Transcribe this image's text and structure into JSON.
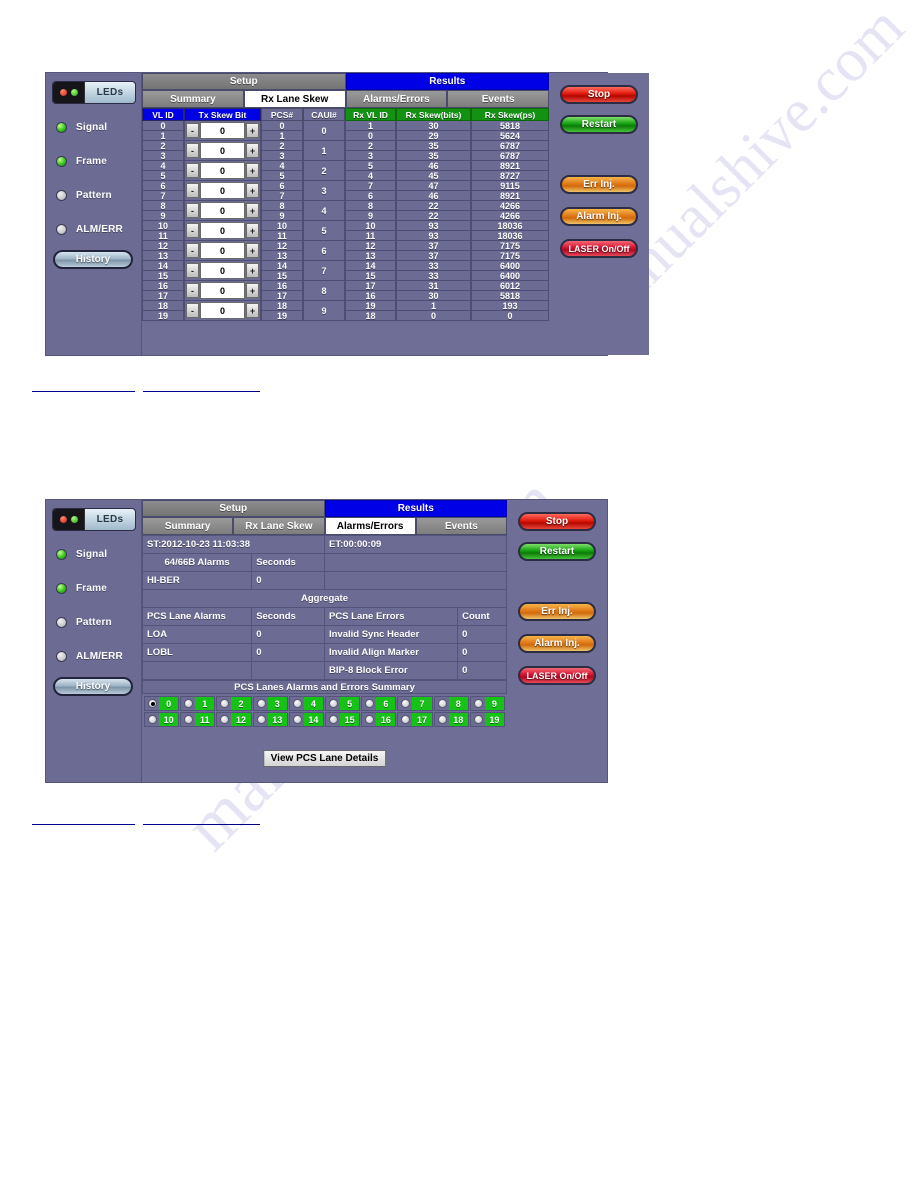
{
  "watermarks": [
    "manualshive.com",
    ".com",
    "ma"
  ],
  "panel1": {
    "name": "Rx Lane Skew screen",
    "leds": {
      "header_label": "LEDs",
      "items": [
        {
          "label": "Signal",
          "state": "on"
        },
        {
          "label": "Frame",
          "state": "on"
        },
        {
          "label": "Pattern",
          "state": "off"
        },
        {
          "label": "ALM/ERR",
          "state": "off"
        }
      ],
      "history_label": "History"
    },
    "main_tabs": [
      {
        "label": "Setup",
        "active": false
      },
      {
        "label": "Results",
        "active": true
      }
    ],
    "sub_tabs": [
      {
        "label": "Summary",
        "active": false
      },
      {
        "label": "Rx Lane Skew",
        "active": true
      },
      {
        "label": "Alarms/Errors",
        "active": false
      },
      {
        "label": "Events",
        "active": false
      }
    ],
    "table": {
      "headers": [
        "VL ID",
        "Tx Skew Bit",
        "PCS#",
        "CAUI#",
        "Rx VL ID",
        "Rx Skew(bits)",
        "Rx Skew(ps)"
      ],
      "vl_ids": [
        "0",
        "1",
        "2",
        "3",
        "4",
        "5",
        "6",
        "7",
        "8",
        "9",
        "10",
        "11",
        "12",
        "13",
        "14",
        "15",
        "16",
        "17",
        "18",
        "19"
      ],
      "tx_skew_values": [
        "0",
        "0",
        "0",
        "0",
        "0",
        "0",
        "0",
        "0",
        "0",
        "0"
      ],
      "spin_minus": "-",
      "spin_plus": "+",
      "pcs_numbers": [
        "0",
        "1",
        "2",
        "3",
        "4",
        "5",
        "6",
        "7",
        "8",
        "9",
        "10",
        "11",
        "12",
        "13",
        "14",
        "15",
        "16",
        "17",
        "18",
        "19"
      ],
      "caui_numbers": [
        "0",
        "1",
        "2",
        "3",
        "4",
        "5",
        "6",
        "7",
        "8",
        "9"
      ],
      "rx_rows": [
        {
          "vl": "1",
          "bits": "30",
          "ps": "5818"
        },
        {
          "vl": "0",
          "bits": "29",
          "ps": "5624"
        },
        {
          "vl": "2",
          "bits": "35",
          "ps": "6787"
        },
        {
          "vl": "3",
          "bits": "35",
          "ps": "6787"
        },
        {
          "vl": "5",
          "bits": "46",
          "ps": "8921"
        },
        {
          "vl": "4",
          "bits": "45",
          "ps": "8727"
        },
        {
          "vl": "7",
          "bits": "47",
          "ps": "9115"
        },
        {
          "vl": "6",
          "bits": "46",
          "ps": "8921"
        },
        {
          "vl": "8",
          "bits": "22",
          "ps": "4266"
        },
        {
          "vl": "9",
          "bits": "22",
          "ps": "4266"
        },
        {
          "vl": "10",
          "bits": "93",
          "ps": "18036"
        },
        {
          "vl": "11",
          "bits": "93",
          "ps": "18036"
        },
        {
          "vl": "12",
          "bits": "37",
          "ps": "7175"
        },
        {
          "vl": "13",
          "bits": "37",
          "ps": "7175"
        },
        {
          "vl": "14",
          "bits": "33",
          "ps": "6400"
        },
        {
          "vl": "15",
          "bits": "33",
          "ps": "6400"
        },
        {
          "vl": "17",
          "bits": "31",
          "ps": "6012"
        },
        {
          "vl": "16",
          "bits": "30",
          "ps": "5818"
        },
        {
          "vl": "19",
          "bits": "1",
          "ps": "193"
        },
        {
          "vl": "18",
          "bits": "0",
          "ps": "0"
        }
      ]
    },
    "buttons": [
      {
        "label": "Stop",
        "style": "stop"
      },
      {
        "label": "Restart",
        "style": "restart"
      },
      {
        "label": "Err Inj.",
        "style": "orange"
      },
      {
        "label": "Alarm Inj.",
        "style": "orange"
      },
      {
        "label": "LASER On/Off",
        "style": "laser"
      }
    ]
  },
  "panel2": {
    "name": "Alarms/Errors screen",
    "leds": {
      "header_label": "LEDs",
      "items": [
        {
          "label": "Signal",
          "state": "on"
        },
        {
          "label": "Frame",
          "state": "on"
        },
        {
          "label": "Pattern",
          "state": "off"
        },
        {
          "label": "ALM/ERR",
          "state": "off"
        }
      ],
      "history_label": "History"
    },
    "main_tabs": [
      {
        "label": "Setup",
        "active": false
      },
      {
        "label": "Results",
        "active": true
      }
    ],
    "sub_tabs": [
      {
        "label": "Summary",
        "active": false
      },
      {
        "label": "Rx Lane Skew",
        "active": false
      },
      {
        "label": "Alarms/Errors",
        "active": true
      },
      {
        "label": "Events",
        "active": false
      }
    ],
    "start_time": "ST:2012-10-23 11:03:38",
    "elapsed_time": "ET:00:00:09",
    "b64_header": {
      "name": "64/66B Alarms",
      "unit": "Seconds"
    },
    "b64_rows": [
      {
        "name": "HI-BER",
        "seconds": "0"
      }
    ],
    "aggregate_label": "Aggregate",
    "pcs_alarms_header": {
      "name": "PCS Lane Alarms",
      "unit": "Seconds"
    },
    "pcs_errors_header": {
      "name": "PCS Lane Errors",
      "unit": "Count"
    },
    "pcs_alarms": [
      {
        "name": "LOA",
        "seconds": "0"
      },
      {
        "name": "LOBL",
        "seconds": "0"
      },
      {
        "name": "",
        "seconds": ""
      }
    ],
    "pcs_errors": [
      {
        "name": "Invalid Sync Header",
        "count": "0"
      },
      {
        "name": "Invalid Align Marker",
        "count": "0"
      },
      {
        "name": "BIP-8 Block Error",
        "count": "0"
      }
    ],
    "lanes_title": "PCS Lanes Alarms and Errors Summary",
    "lanes": [
      {
        "num": "0",
        "selected": true
      },
      {
        "num": "1",
        "selected": false
      },
      {
        "num": "2",
        "selected": false
      },
      {
        "num": "3",
        "selected": false
      },
      {
        "num": "4",
        "selected": false
      },
      {
        "num": "5",
        "selected": false
      },
      {
        "num": "6",
        "selected": false
      },
      {
        "num": "7",
        "selected": false
      },
      {
        "num": "8",
        "selected": false
      },
      {
        "num": "9",
        "selected": false
      },
      {
        "num": "10",
        "selected": false
      },
      {
        "num": "11",
        "selected": false
      },
      {
        "num": "12",
        "selected": false
      },
      {
        "num": "13",
        "selected": false
      },
      {
        "num": "14",
        "selected": false
      },
      {
        "num": "15",
        "selected": false
      },
      {
        "num": "16",
        "selected": false
      },
      {
        "num": "17",
        "selected": false
      },
      {
        "num": "18",
        "selected": false
      },
      {
        "num": "19",
        "selected": false
      }
    ],
    "view_details_label": "View PCS Lane Details",
    "buttons": [
      {
        "label": "Stop",
        "style": "stop"
      },
      {
        "label": "Restart",
        "style": "restart"
      },
      {
        "label": "Err Inj.",
        "style": "orange"
      },
      {
        "label": "Alarm Inj.",
        "style": "orange"
      },
      {
        "label": "LASER On/Off",
        "style": "laser"
      }
    ]
  },
  "colors": {
    "panel_bg": "#6e6e96",
    "tab_active": "#0000e6",
    "header_green": "#139113",
    "lane_green": "#15c215",
    "link": "#00008b"
  }
}
